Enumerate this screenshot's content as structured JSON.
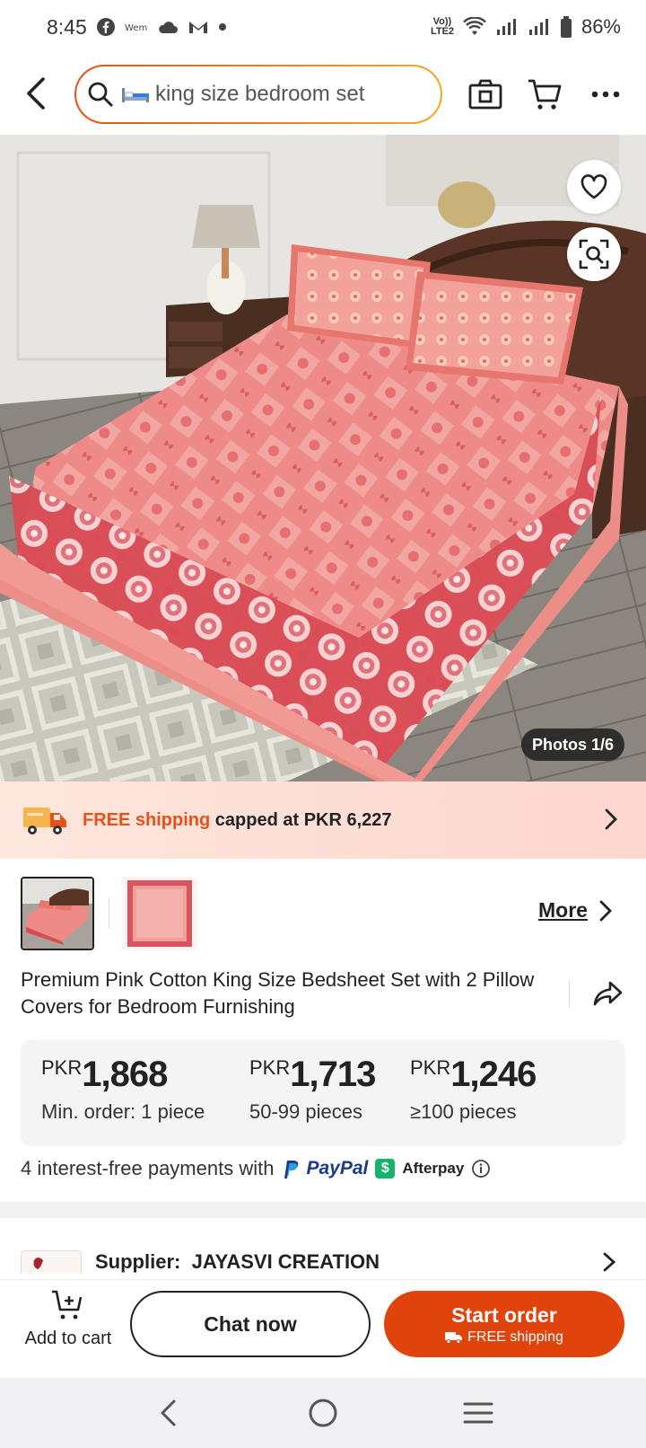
{
  "status_bar": {
    "time": "8:45",
    "battery": "86%",
    "network_label": "Vo)) LTE2",
    "icons": [
      "facebook-icon",
      "wemu-icon",
      "cloud-icon",
      "gmail-icon",
      "dot-icon",
      "wifi-icon",
      "signal-icon",
      "signal-icon",
      "battery-icon"
    ]
  },
  "top_bar": {
    "search_query": "king size bedroom set",
    "icons": [
      "back-arrow-icon",
      "search-icon",
      "bed-emoji-icon",
      "camera-icon",
      "cart-icon",
      "more-icon"
    ]
  },
  "hero": {
    "photos_counter": "Photos 1/6",
    "icons": [
      "heart-icon",
      "image-search-icon"
    ]
  },
  "shipping": {
    "free_label": "FREE shipping",
    "rest_label": "capped at PKR 6,227",
    "icon": "delivery-truck-icon"
  },
  "thumbnails": {
    "more_label": "More"
  },
  "product": {
    "title": "Premium Pink Cotton King Size Bedsheet Set with 2 Pillow Covers for Bedroom Furnishing"
  },
  "price_tiers": [
    {
      "currency": "PKR",
      "price": "1,868",
      "qty": "Min. order: 1 piece"
    },
    {
      "currency": "PKR",
      "price": "1,713",
      "qty": "50-99 pieces"
    },
    {
      "currency": "PKR",
      "price": "1,246",
      "qty": "≥100 pieces"
    }
  ],
  "payments": {
    "text": "4 interest-free payments with",
    "paypal": "PayPal",
    "afterpay": "Afterpay"
  },
  "supplier": {
    "label": "Supplier:",
    "name": "JAYASVI CREATION"
  },
  "actions": {
    "add_to_cart": "Add to cart",
    "chat_now": "Chat now",
    "start_order": "Start order",
    "start_order_sub": "FREE shipping"
  },
  "colors": {
    "brand_orange": "#e0430b",
    "search_border_start": "#e8501a",
    "search_border_end": "#f5a623",
    "shipping_highlight": "#e8501a",
    "paypal_blue": "#1c3b8a",
    "afterpay_green": "#17b36b"
  }
}
